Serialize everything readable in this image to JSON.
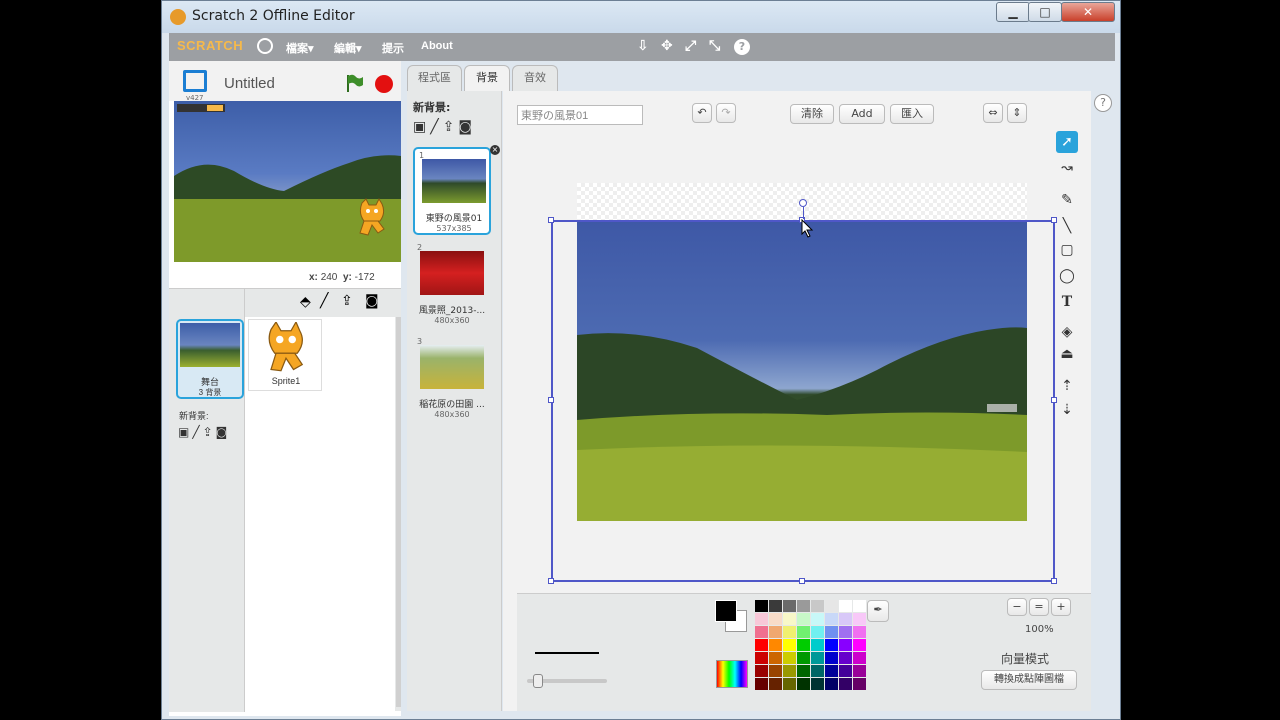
{
  "window": {
    "title": "Scratch 2 Offline Editor",
    "minimize": "▁",
    "maximize": "□",
    "close": "✕"
  },
  "menubar": {
    "logo": "SCRATCH",
    "items": [
      "檔案▾",
      "編輯▾",
      "提示",
      "About"
    ],
    "tools": [
      "⇩",
      "✥",
      "⤢",
      "⤡",
      "?"
    ]
  },
  "stage": {
    "version": "v427",
    "project_title": "Untitled",
    "coords_x_label": "x:",
    "coords_x": "240",
    "coords_y_label": "y:",
    "coords_y": "-172"
  },
  "sprites": {
    "stage_label": "舞台",
    "stage_count": "3 背景",
    "new_backdrop_label": "新背景:",
    "sprite_name": "Sprite1"
  },
  "tabs": [
    "程式區",
    "背景",
    "音效"
  ],
  "costumes": {
    "header": "新背景:",
    "items": [
      {
        "num": "1",
        "name": "東野の風景01",
        "size": "537x385",
        "color1": "#3e58a6",
        "color2": "#7c9b2e"
      },
      {
        "num": "2",
        "name": "風景照_2013-...",
        "size": "480x360",
        "color1": "#c01818",
        "color2": "#e84040"
      },
      {
        "num": "3",
        "name": "稲花原の田園 ...",
        "size": "480x360",
        "color1": "#9ab36a",
        "color2": "#c8b33a"
      }
    ]
  },
  "editor": {
    "costume_name": "東野の風景01",
    "clear": "清除",
    "add": "Add",
    "import": "匯入",
    "zoom": "100%",
    "mode_label": "向量模式",
    "convert_button": "轉換成點陣圖檔"
  },
  "colors": {
    "accent": "#2aa3db",
    "selection": "#4f57c8",
    "stop": "#e31010",
    "flag": "#3e8e2a"
  }
}
